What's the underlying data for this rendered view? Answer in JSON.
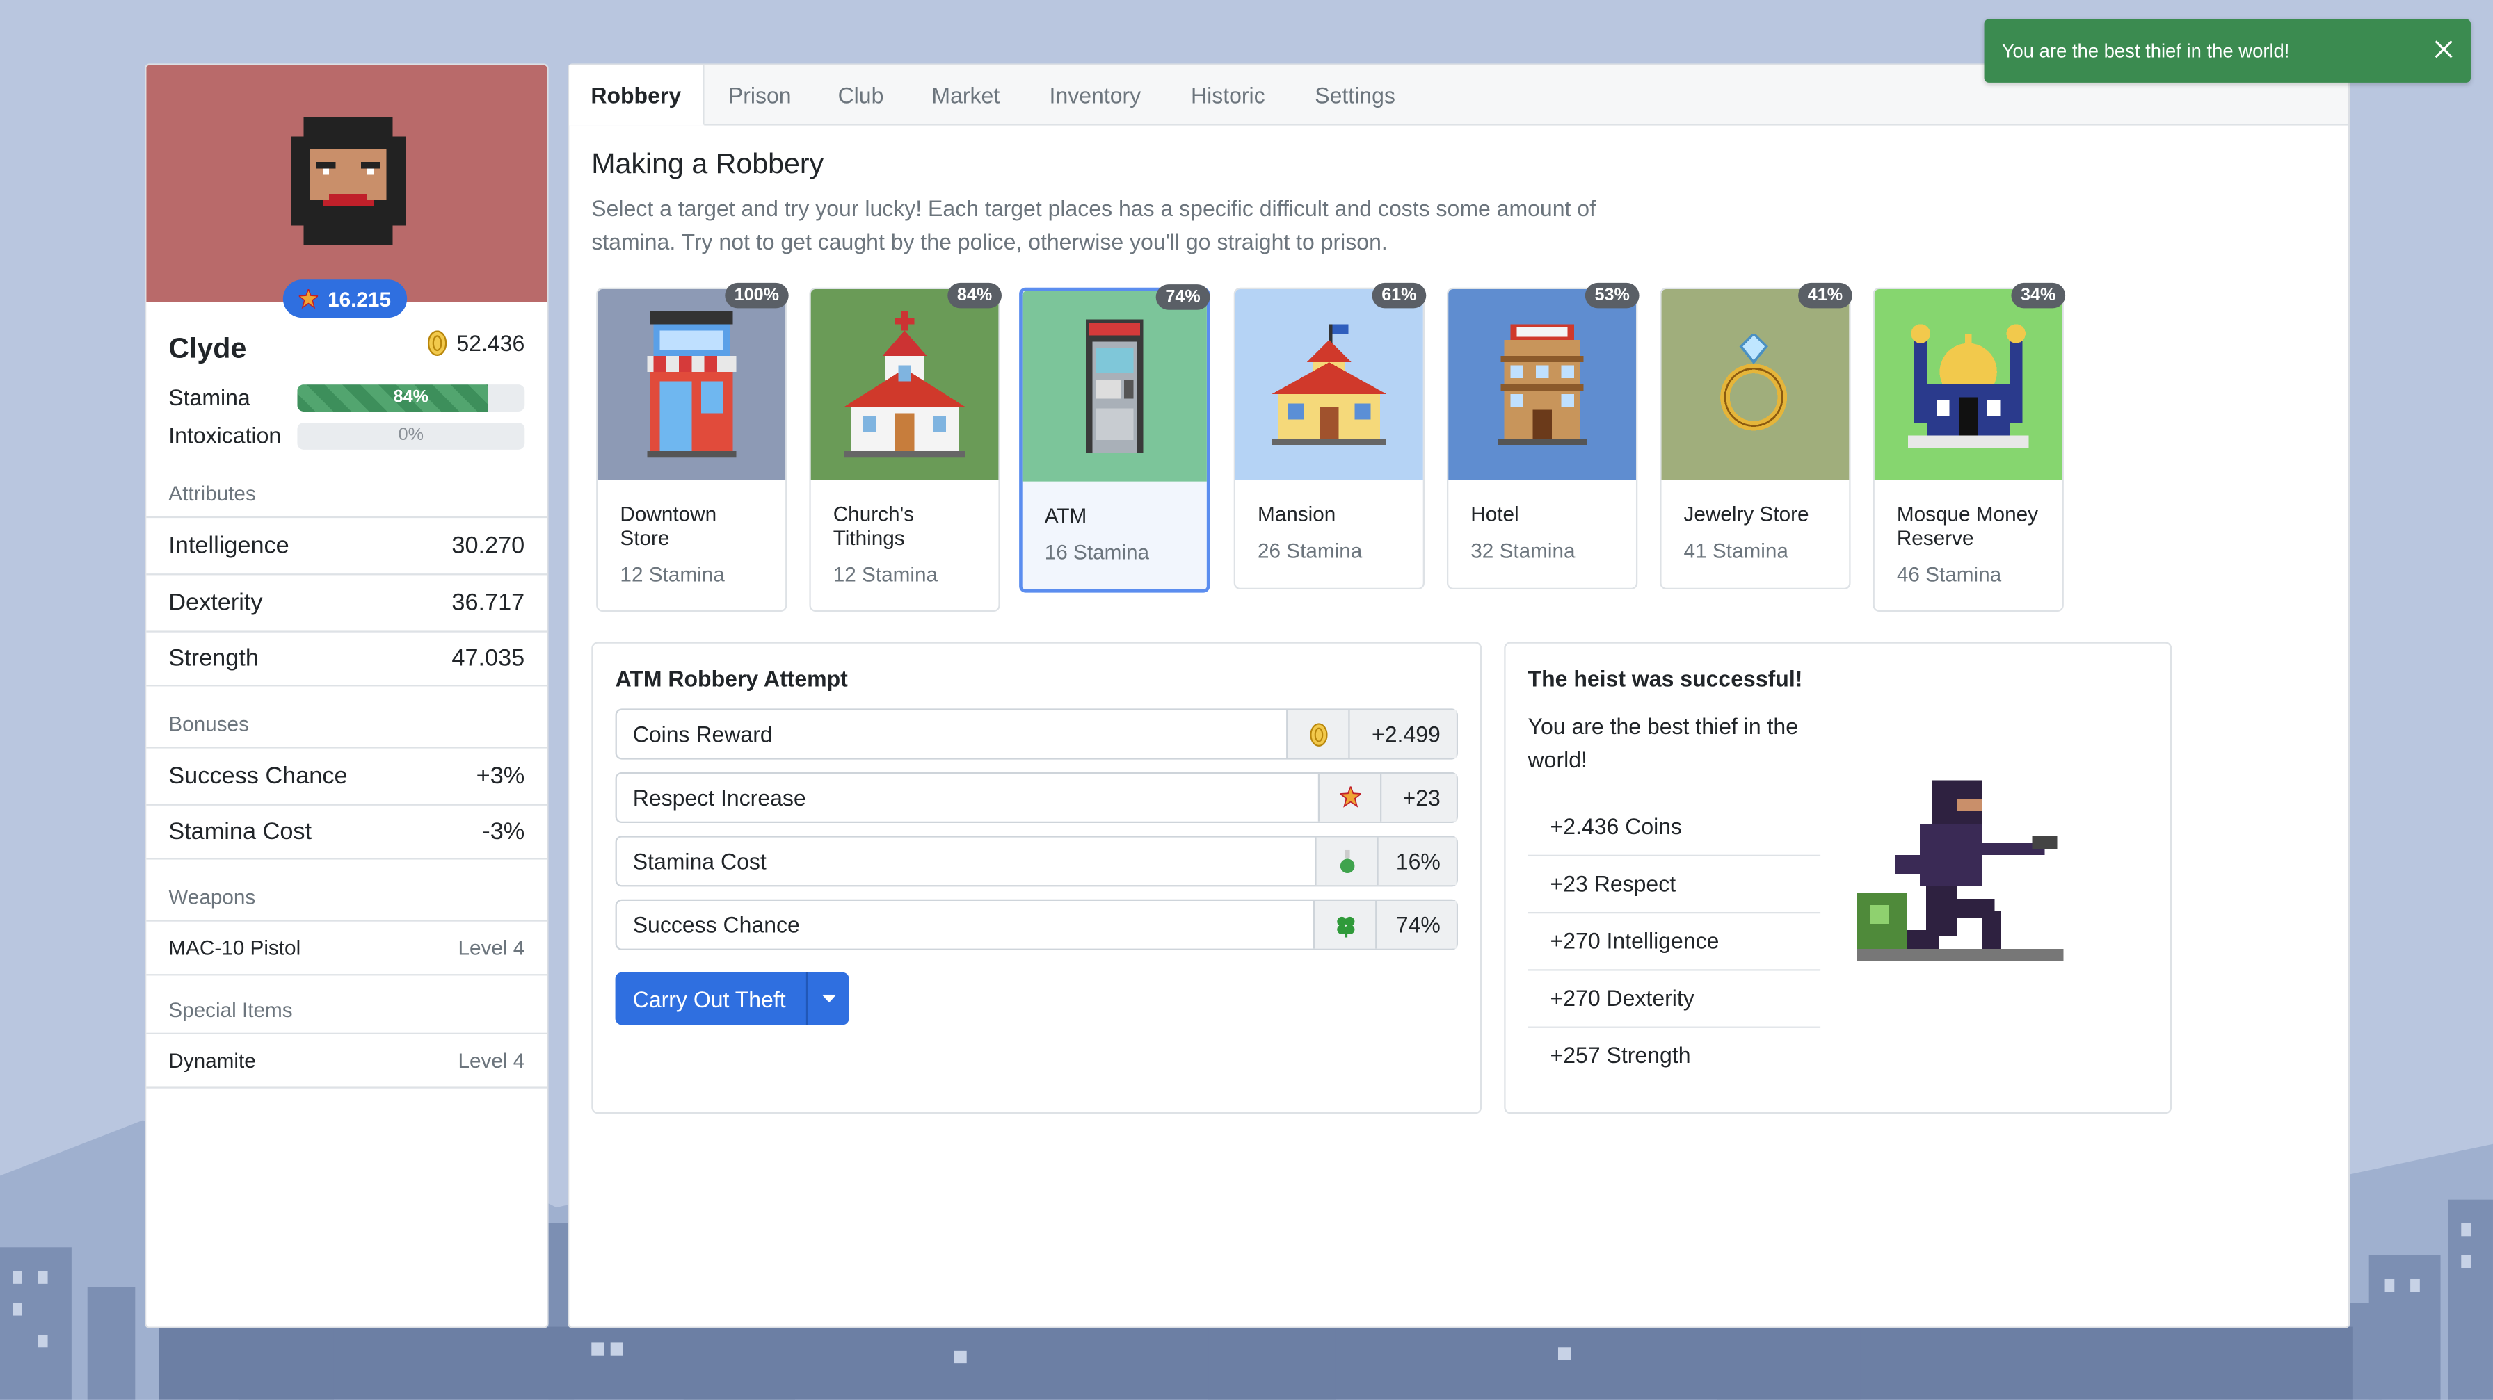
{
  "toast": {
    "message": "You are the best thief in the world!",
    "close_icon": "close-icon",
    "color": "#3b8b50"
  },
  "player": {
    "name": "Clyde",
    "respect": "16.215",
    "coins": "52.436",
    "stamina": {
      "label": "Stamina",
      "value_text": "84%",
      "fraction": 0.84
    },
    "intoxication": {
      "label": "Intoxication",
      "value_text": "0%",
      "fraction": 0
    }
  },
  "attributes": {
    "heading": "Attributes",
    "items": [
      {
        "label": "Intelligence",
        "value": "30.270"
      },
      {
        "label": "Dexterity",
        "value": "36.717"
      },
      {
        "label": "Strength",
        "value": "47.035"
      }
    ]
  },
  "bonuses": {
    "heading": "Bonuses",
    "items": [
      {
        "label": "Success Chance",
        "value": "+3%"
      },
      {
        "label": "Stamina Cost",
        "value": "-3%"
      }
    ]
  },
  "weapons": {
    "heading": "Weapons",
    "items": [
      {
        "label": "MAC-10 Pistol",
        "value": "Level 4"
      }
    ]
  },
  "special_items": {
    "heading": "Special Items",
    "items": [
      {
        "label": "Dynamite",
        "value": "Level 4"
      }
    ]
  },
  "tabs": [
    "Robbery",
    "Prison",
    "Club",
    "Market",
    "Inventory",
    "Historic",
    "Settings"
  ],
  "active_tab": "Robbery",
  "robbery": {
    "title": "Making a Robbery",
    "description": "Select a target and try your lucky! Each target places has a specific difficult and costs some amount of stamina. Try not to get caught by the police, otherwise you'll go straight to prison.",
    "targets": [
      {
        "name": "Downtown Store",
        "stamina": "12 Stamina",
        "chance": "100%",
        "bg": "#8d9ab5",
        "icon": "store-icon"
      },
      {
        "name": "Church's Tithings",
        "stamina": "12 Stamina",
        "chance": "84%",
        "bg": "#6a9b57",
        "icon": "church-icon"
      },
      {
        "name": "ATM",
        "stamina": "16 Stamina",
        "chance": "74%",
        "bg": "#7cc59a",
        "icon": "atm-icon"
      },
      {
        "name": "Mansion",
        "stamina": "26 Stamina",
        "chance": "61%",
        "bg": "#b5d3f5",
        "icon": "mansion-icon"
      },
      {
        "name": "Hotel",
        "stamina": "32 Stamina",
        "chance": "53%",
        "bg": "#5f8dd0",
        "icon": "hotel-icon"
      },
      {
        "name": "Jewelry Store",
        "stamina": "41 Stamina",
        "chance": "41%",
        "bg": "#a0ae7c",
        "icon": "ring-icon"
      },
      {
        "name": "Mosque Money Reserve",
        "stamina": "46 Stamina",
        "chance": "34%",
        "bg": "#86d66f",
        "icon": "mosque-icon"
      }
    ],
    "selected_target": "ATM"
  },
  "attempt": {
    "title": "ATM Robbery Attempt",
    "rows": [
      {
        "label": "Coins Reward",
        "icon": "coin-icon",
        "value": "+2.499"
      },
      {
        "label": "Respect Increase",
        "icon": "star-medal-icon",
        "value": "+23"
      },
      {
        "label": "Stamina Cost",
        "icon": "potion-icon",
        "value": "16%"
      },
      {
        "label": "Success Chance",
        "icon": "clover-icon",
        "value": "74%"
      }
    ],
    "button": "Carry Out Theft"
  },
  "result": {
    "title": "The heist was successful!",
    "message": "You are the best thief in the world!",
    "rewards": [
      "+2.436 Coins",
      "+23 Respect",
      "+270 Intelligence",
      "+270 Dexterity",
      "+257 Strength"
    ]
  }
}
